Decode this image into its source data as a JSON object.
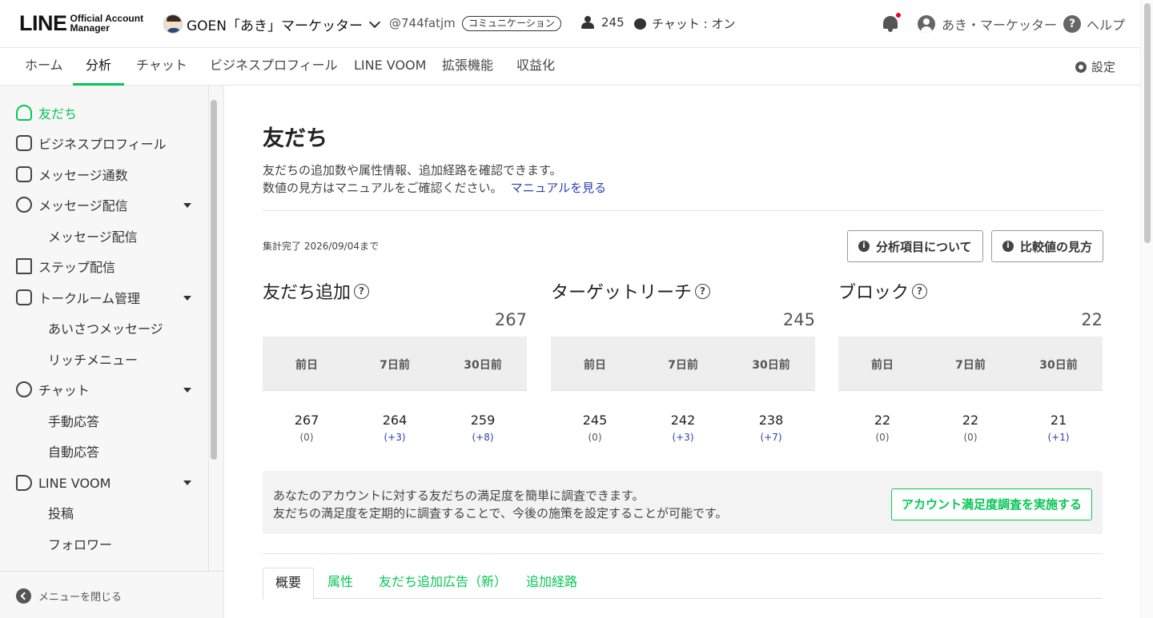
{
  "header": {
    "logo_main": "LINE",
    "logo_sub": "Official Account Manager",
    "account_name": "GOEN「あき」マーケッター",
    "account_id": "@744fatjm",
    "category": "コミュニケーション",
    "friend_count": "245",
    "chat_status": "チャット : オン",
    "user_name": "あき・マーケッター",
    "help_label": "ヘルプ"
  },
  "nav": {
    "tabs": [
      {
        "label": "ホーム"
      },
      {
        "label": "分析"
      },
      {
        "label": "チャット"
      },
      {
        "label": "ビジネスプロフィール"
      },
      {
        "label": "LINE VOOM"
      },
      {
        "label": "拡張機能"
      },
      {
        "label": "収益化"
      }
    ],
    "active_tab": "分析",
    "settings_label": "設定"
  },
  "sidebar": {
    "items": [
      {
        "label": "友だち",
        "icon": "add-friend-icon"
      },
      {
        "label": "ビジネスプロフィール",
        "icon": "profile-icon"
      },
      {
        "label": "メッセージ通数",
        "icon": "inbox-icon"
      },
      {
        "label": "メッセージ配信",
        "icon": "broadcast-icon"
      },
      {
        "label": "メッセージ配信"
      },
      {
        "label": "ステップ配信",
        "icon": "step-icon"
      },
      {
        "label": "トークルーム管理",
        "icon": "talkroom-icon"
      },
      {
        "label": "あいさつメッセージ"
      },
      {
        "label": "リッチメニュー"
      },
      {
        "label": "チャット",
        "icon": "chat-icon"
      },
      {
        "label": "手動応答"
      },
      {
        "label": "自動応答"
      },
      {
        "label": "LINE VOOM",
        "icon": "voom-icon"
      },
      {
        "label": "投稿"
      },
      {
        "label": "フォロワー"
      }
    ],
    "active_item": "友だち",
    "close_menu_label": "メニューを閉じる"
  },
  "main": {
    "title": "友だち",
    "description_line1": "友だちの追加数や属性情報、追加経路を確認できます。",
    "description_line2": "数値の見方はマニュアルをご確認ください。",
    "manual_link": "マニュアルを見る",
    "aggregation_note": "集計完了 2026/09/04まで",
    "btn_about_items": "分析項目について",
    "btn_comparison": "比較値の見方",
    "stats": [
      {
        "title": "友だち追加",
        "total": "267",
        "headers": [
          "前日",
          "7日前",
          "30日前"
        ],
        "values": [
          "267",
          "264",
          "259"
        ],
        "diffs": [
          "(0)",
          "(+3)",
          "(+8)"
        ]
      },
      {
        "title": "ターゲットリーチ",
        "total": "245",
        "headers": [
          "前日",
          "7日前",
          "30日前"
        ],
        "values": [
          "245",
          "242",
          "238"
        ],
        "diffs": [
          "(0)",
          "(+3)",
          "(+7)"
        ]
      },
      {
        "title": "ブロック",
        "total": "22",
        "headers": [
          "前日",
          "7日前",
          "30日前"
        ],
        "values": [
          "22",
          "22",
          "21"
        ],
        "diffs": [
          "(0)",
          "(0)",
          "(+1)"
        ]
      }
    ],
    "survey_line1": "あなたのアカウントに対する友だちの満足度を簡単に調査できます。",
    "survey_line2": "友だちの満足度を定期的に調査することで、今後の施策を設定することが可能です。",
    "survey_button": "アカウント満足度調査を実施する",
    "tabs": [
      {
        "label": "概要"
      },
      {
        "label": "属性"
      },
      {
        "label": "友だち追加広告（新）"
      },
      {
        "label": "追加経路"
      }
    ],
    "active_tab": "概要"
  },
  "colors": {
    "accent_green": "#06c755",
    "link_blue": "#2d41b3",
    "notification_dot": "#ee0022"
  }
}
